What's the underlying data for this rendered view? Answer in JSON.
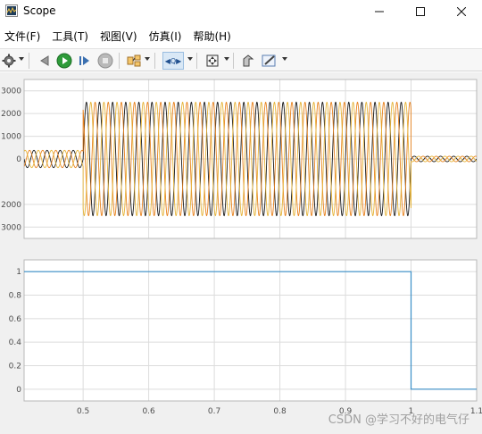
{
  "window": {
    "title": "Scope"
  },
  "menu": [
    {
      "label": "文件(F)"
    },
    {
      "label": "工具(T)"
    },
    {
      "label": "视图(V)"
    },
    {
      "label": "仿真(I)"
    },
    {
      "label": "帮助(H)"
    }
  ],
  "toolbar": {
    "icons": [
      "settings-icon",
      "arrow-back-icon",
      "run-icon",
      "step-forward-icon",
      "stop-icon",
      "highlight-icon",
      "zoom-icon",
      "fit-view-icon",
      "restore-icon",
      "edit-icon"
    ]
  },
  "colors": {
    "signal_black": "#1a1a1a",
    "signal_orange": "#e8831f",
    "signal_yellow": "#e6b43a",
    "step_line": "#3a8fc8",
    "grid": "#dcdcdc"
  },
  "chart_data": [
    {
      "type": "line",
      "title": "",
      "xlabel": "",
      "ylabel": "",
      "xlim": [
        0.41,
        1.1
      ],
      "ylim": [
        -3500,
        3500
      ],
      "yticks": [
        3000,
        2000,
        1000,
        0,
        2000,
        3000
      ],
      "ytick_labels": [
        "3000",
        "2000",
        "1000",
        "0",
        "2000",
        "3000"
      ],
      "grid": true,
      "series": [
        {
          "color": "#1a1a1a",
          "phase": 0.0,
          "segments": [
            {
              "x": [
                0.41,
                0.5
              ],
              "amplitude": 380
            },
            {
              "x": [
                0.5,
                1.0
              ],
              "amplitude": 2500,
              "peak": 3000
            },
            {
              "x": [
                1.0,
                1.1
              ],
              "amplitude": 120
            }
          ]
        },
        {
          "color": "#e8831f",
          "phase": 2.094,
          "segments": [
            {
              "x": [
                0.41,
                0.5
              ],
              "amplitude": 380
            },
            {
              "x": [
                0.5,
                1.0
              ],
              "amplitude": 2500,
              "peak": -2800
            },
            {
              "x": [
                1.0,
                1.1
              ],
              "amplitude": 120
            }
          ]
        },
        {
          "color": "#e6b43a",
          "phase": 4.189,
          "segments": [
            {
              "x": [
                0.41,
                0.5
              ],
              "amplitude": 380
            },
            {
              "x": [
                0.5,
                1.0
              ],
              "amplitude": 2500
            },
            {
              "x": [
                1.0,
                1.1
              ],
              "amplitude": 120
            }
          ]
        }
      ]
    },
    {
      "type": "line",
      "title": "",
      "xlabel": "",
      "ylabel": "",
      "xlim": [
        0.41,
        1.1
      ],
      "ylim": [
        -0.1,
        1.1
      ],
      "yticks": [
        1,
        0.8,
        0.6,
        0.4,
        0.2,
        0
      ],
      "ytick_labels": [
        "1",
        "0.8",
        "0.6",
        "0.4",
        "0.2",
        "0"
      ],
      "xticks": [
        0.5,
        0.6,
        0.7,
        0.8,
        0.9,
        1.0,
        1.1
      ],
      "xtick_labels": [
        "0.5",
        "0.6",
        "0.7",
        "0.8",
        "0.9",
        "1",
        "1.1"
      ],
      "grid": true,
      "series": [
        {
          "color": "#3a8fc8",
          "x": [
            0.41,
            1.0,
            1.0,
            1.1
          ],
          "y": [
            1,
            1,
            0,
            0
          ]
        }
      ]
    }
  ],
  "watermark": "CSDN @学习不好的电气仔"
}
